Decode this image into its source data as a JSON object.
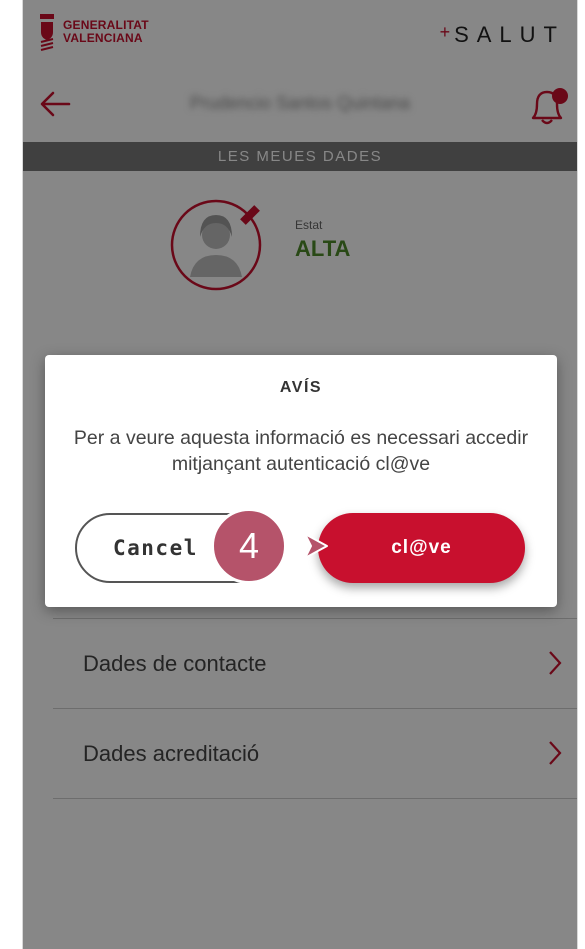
{
  "header": {
    "logo_line1": "GENERALITAT",
    "logo_line2": "VALENCIANA",
    "brand_plus": "+",
    "brand": "SALUT"
  },
  "nav": {
    "back_icon": "arrow-left-icon",
    "patient_name": "Prudencio Santos Quintana",
    "bell_icon": "bell-notification-icon"
  },
  "section": {
    "title": "LES MEUES DADES"
  },
  "profile": {
    "avatar_icon": "user-avatar-icon",
    "edit_icon": "pencil-icon",
    "status_label": "Estat",
    "status_value": "ALTA"
  },
  "list": [
    {
      "label": "Dades de contacte",
      "icon": "chevron-right-icon"
    },
    {
      "label": "Dades acreditació",
      "icon": "chevron-right-icon"
    }
  ],
  "dialog": {
    "title": "AVÍS",
    "message": "Per a veure aquesta informació es necessari accedir mitjançant autenticació cl@ve",
    "cancel_label": "Cancel",
    "confirm_label": "cl@ve"
  },
  "annotation": {
    "step": "4"
  },
  "colors": {
    "brand_red": "#c8102e",
    "status_green": "#4e8a2a",
    "section_bar": "#7a7a7a",
    "step_badge": "#b5536a"
  }
}
